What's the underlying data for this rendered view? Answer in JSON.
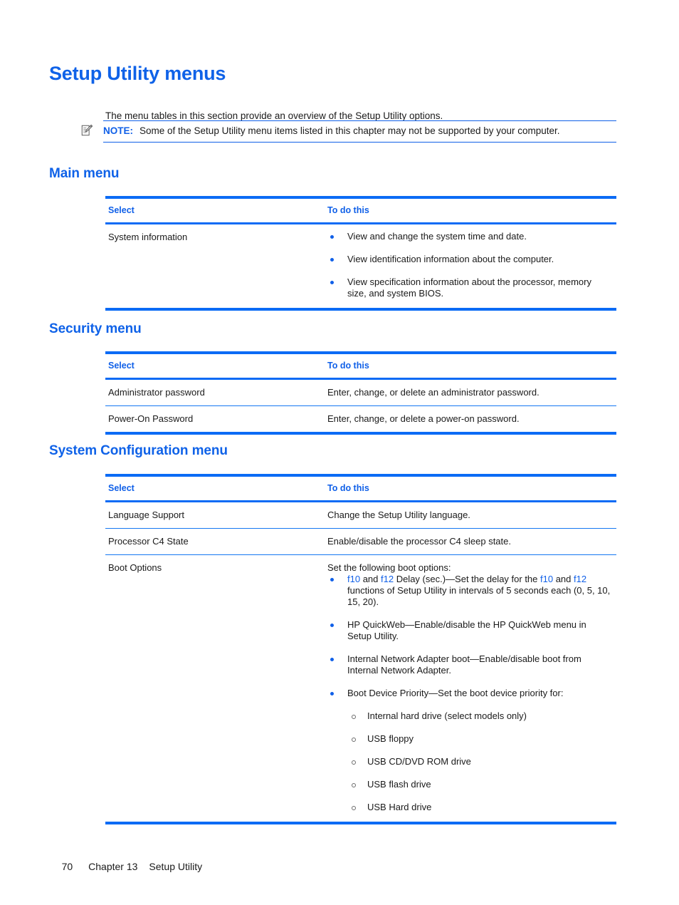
{
  "document": {
    "title": "Setup Utility menus",
    "intro": "The menu tables in this section provide an overview of the Setup Utility options."
  },
  "note": {
    "icon": "note-pencil-icon",
    "label": "NOTE:",
    "text": "Some of the Setup Utility menu items listed in this chapter may not be supported by your computer."
  },
  "colors": {
    "heading_blue": "#0F62E8",
    "rule_blue": "#0B6BF5",
    "thin_rule_blue": "#1578F2",
    "link_blue": "#1060E8",
    "body_text": "#1a1a1a"
  },
  "columns": {
    "select": "Select",
    "to_do_this": "To do this"
  },
  "sections": [
    {
      "heading": "Main menu",
      "rows": [
        {
          "select": "System information",
          "bullets": [
            "View and change the system time and date.",
            "View identification information about the computer.",
            "View specification information about the processor, memory size, and system BIOS."
          ]
        }
      ]
    },
    {
      "heading": "Security menu",
      "rows": [
        {
          "select": "Administrator password",
          "text": "Enter, change, or delete an administrator password."
        },
        {
          "select": "Power-On Password",
          "text": "Enter, change, or delete a power-on password."
        }
      ]
    },
    {
      "heading": "System Configuration menu",
      "rows": [
        {
          "select": "Language Support",
          "text": "Change the Setup Utility language."
        },
        {
          "select": "Processor C4 State",
          "text": "Enable/disable the processor C4 sleep state."
        },
        {
          "select": "Boot Options",
          "lead": "Set the following boot options:",
          "bullets": [
            {
              "segments": [
                {
                  "text": "f10",
                  "link": true
                },
                {
                  "text": " and ",
                  "link": false
                },
                {
                  "text": "f12",
                  "link": true
                },
                {
                  "text": " Delay (sec.)—Set the delay for the ",
                  "link": false
                },
                {
                  "text": "f10",
                  "link": true
                },
                {
                  "text": " and ",
                  "link": false
                },
                {
                  "text": "f12",
                  "link": true
                },
                {
                  "text": " functions of Setup Utility in intervals of 5 seconds each (0, 5, 10, 15, 20).",
                  "link": false
                }
              ]
            },
            {
              "segments": [
                {
                  "text": "HP QuickWeb—Enable/disable the HP QuickWeb menu in Setup Utility.",
                  "link": false
                }
              ]
            },
            {
              "segments": [
                {
                  "text": "Internal Network Adapter boot—Enable/disable boot from Internal Network Adapter.",
                  "link": false
                }
              ]
            },
            {
              "segments": [
                {
                  "text": "Boot Device Priority—Set the boot device priority for:",
                  "link": false
                }
              ],
              "sub": [
                "Internal hard drive (select models only)",
                "USB floppy",
                "USB CD/DVD ROM drive",
                "USB flash drive",
                "USB Hard drive"
              ]
            }
          ]
        }
      ]
    }
  ],
  "footer": {
    "page_number": "70",
    "chapter": "Chapter 13",
    "chapter_title": "Setup Utility"
  }
}
